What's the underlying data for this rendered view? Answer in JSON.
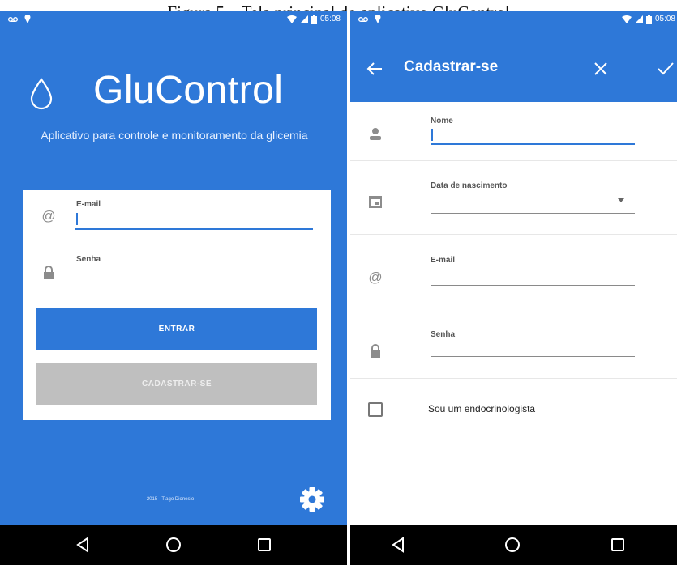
{
  "caption": "Figura 5 – Tela principal do aplicativo GluControl",
  "status_bar": {
    "time_left": "05:08",
    "time_right": "05:08"
  },
  "login_screen": {
    "app_title": "GluControl",
    "subtitle": "Aplicativo para controle e monitoramento da glicemia",
    "email_label": "E-mail",
    "password_label": "Senha",
    "enter_button": "ENTRAR",
    "register_button": "CADASTRAR-SE",
    "footer": "2015 - Tiago Dionesio"
  },
  "register_screen": {
    "title": "Cadastrar-se",
    "name_label": "Nome",
    "birthdate_label": "Data de nascimento",
    "email_label": "E-mail",
    "password_label": "Senha",
    "endocrinologist_label": "Sou um endocrinologista"
  },
  "colors": {
    "primary": "#2e78d8",
    "disabled": "#bfbfbf",
    "navbar": "#000000"
  },
  "icons": [
    "water-drop-icon",
    "gear-icon",
    "at-icon",
    "lock-icon",
    "person-icon",
    "calendar-icon",
    "back-arrow-icon",
    "close-icon",
    "check-icon",
    "nav-back-icon",
    "nav-home-icon",
    "nav-recents-icon"
  ]
}
